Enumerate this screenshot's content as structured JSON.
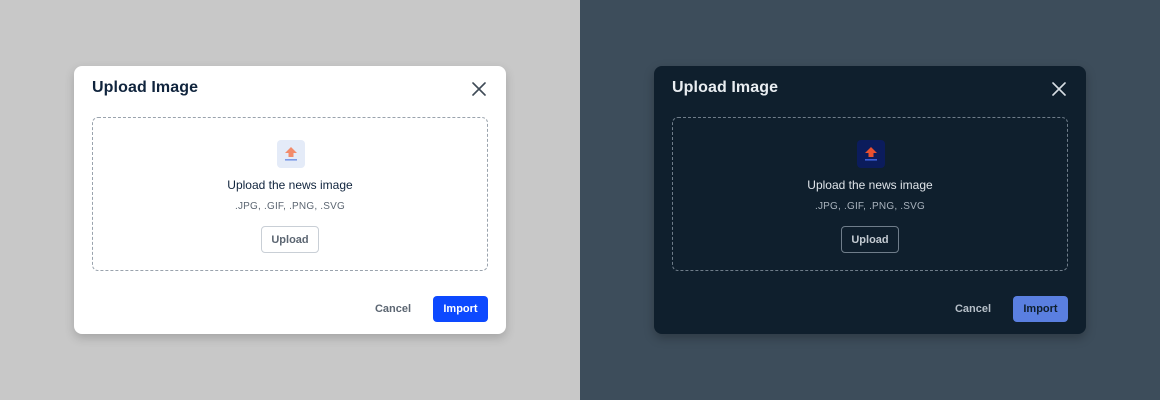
{
  "light": {
    "title": "Upload Image",
    "dropzone": {
      "title": "Upload the news image",
      "formats": ".JPG, .GIF, .PNG, .SVG",
      "upload_label": "Upload"
    },
    "footer": {
      "cancel_label": "Cancel",
      "import_label": "Import"
    },
    "icons": {
      "close": "close-icon",
      "upload": "upload-arrow-icon"
    },
    "colors": {
      "background": "#c8c8c8",
      "modal": "#ffffff",
      "accent": "#0d49ff",
      "upload_icon": "#f28b6b"
    }
  },
  "dark": {
    "title": "Upload Image",
    "dropzone": {
      "title": "Upload the news image",
      "formats": ".JPG, .GIF, .PNG, .SVG",
      "upload_label": "Upload"
    },
    "footer": {
      "cancel_label": "Cancel",
      "import_label": "Import"
    },
    "icons": {
      "close": "close-icon",
      "upload": "upload-arrow-icon"
    },
    "colors": {
      "background": "#3d4d5b",
      "modal": "#0f1f2d",
      "accent": "#5a7fe0",
      "upload_icon": "#e8502f"
    }
  }
}
